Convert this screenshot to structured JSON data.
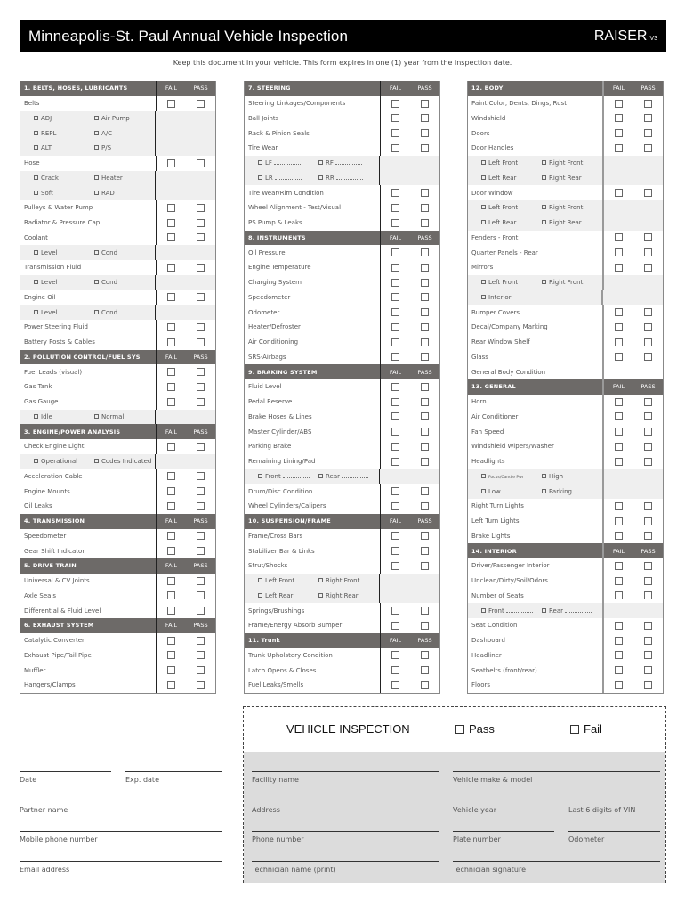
{
  "header": {
    "title": "Minneapolis-St. Paul Annual Vehicle Inspection",
    "brand": "RAISER",
    "version": "V3",
    "subtitle": "Keep this document in your vehicle. This form expires in one (1) year from the inspection date."
  },
  "columns_labels": {
    "fail": "FAIL",
    "pass": "PASS"
  },
  "col1": [
    {
      "type": "hdr",
      "label": "1. BELTS, HOSES, LUBRICANTS"
    },
    {
      "type": "item",
      "label": "Belts"
    },
    {
      "type": "sub",
      "opts": [
        "ADJ",
        "Air Pump"
      ]
    },
    {
      "type": "sub",
      "opts": [
        "REPL",
        "A/C"
      ]
    },
    {
      "type": "sub",
      "opts": [
        "ALT",
        "P/S"
      ]
    },
    {
      "type": "item",
      "label": "Hose"
    },
    {
      "type": "sub",
      "opts": [
        "Crack",
        "Heater"
      ]
    },
    {
      "type": "sub",
      "opts": [
        "Soft",
        "RAD"
      ]
    },
    {
      "type": "item",
      "label": "Pulleys & Water Pump"
    },
    {
      "type": "item",
      "label": "Radiator & Pressure Cap"
    },
    {
      "type": "item",
      "label": "Coolant"
    },
    {
      "type": "sub",
      "opts": [
        "Level",
        "Cond"
      ]
    },
    {
      "type": "item",
      "label": "Transmission Fluid"
    },
    {
      "type": "sub",
      "opts": [
        "Level",
        "Cond"
      ]
    },
    {
      "type": "item",
      "label": "Engine Oil"
    },
    {
      "type": "sub",
      "opts": [
        "Level",
        "Cond"
      ]
    },
    {
      "type": "item",
      "label": "Power Steering Fluid"
    },
    {
      "type": "item",
      "label": "Battery Posts & Cables"
    },
    {
      "type": "hdr",
      "label": "2. POLLUTION CONTROL/FUEL SYS"
    },
    {
      "type": "item",
      "label": "Fuel Leads (visual)"
    },
    {
      "type": "item",
      "label": "Gas Tank"
    },
    {
      "type": "item",
      "label": "Gas Gauge"
    },
    {
      "type": "sub",
      "opts": [
        "Idle",
        "Normal"
      ]
    },
    {
      "type": "hdr",
      "label": "3. ENGINE/POWER ANALYSIS"
    },
    {
      "type": "item",
      "label": "Check Engine Light"
    },
    {
      "type": "sub",
      "opts": [
        "Operational",
        "Codes Indicated"
      ]
    },
    {
      "type": "item",
      "label": "Acceleration Cable"
    },
    {
      "type": "item",
      "label": "Engine Mounts"
    },
    {
      "type": "item",
      "label": "Oil Leaks"
    },
    {
      "type": "hdr",
      "label": "4. TRANSMISSION"
    },
    {
      "type": "item",
      "label": "Speedometer"
    },
    {
      "type": "item",
      "label": "Gear Shift Indicator"
    },
    {
      "type": "hdr",
      "label": "5. DRIVE TRAIN"
    },
    {
      "type": "item",
      "label": "Universal & CV Joints"
    },
    {
      "type": "item",
      "label": "Axle Seals"
    },
    {
      "type": "item",
      "label": "Differential & Fluid Level"
    },
    {
      "type": "hdr",
      "label": "6. EXHAUST SYSTEM"
    },
    {
      "type": "item",
      "label": "Catalytic Converter"
    },
    {
      "type": "item",
      "label": "Exhaust Pipe/Tail Pipe"
    },
    {
      "type": "item",
      "label": "Muffler"
    },
    {
      "type": "item",
      "label": "Hangers/Clamps"
    }
  ],
  "col2": [
    {
      "type": "hdr",
      "label": "7. STEERING"
    },
    {
      "type": "item",
      "label": "Steering Linkages/Components"
    },
    {
      "type": "item",
      "label": "Ball Joints"
    },
    {
      "type": "item",
      "label": "Rack & Pinion Seals"
    },
    {
      "type": "item",
      "label": "Tire Wear"
    },
    {
      "type": "sub",
      "opts": [
        "LF",
        "RF"
      ],
      "blanks": true
    },
    {
      "type": "sub",
      "opts": [
        "LR",
        "RR"
      ],
      "blanks": true
    },
    {
      "type": "item",
      "label": "Tire Wear/Rim Condition"
    },
    {
      "type": "item",
      "label": "Wheel Alignment - Test/Visual"
    },
    {
      "type": "item",
      "label": "PS Pump & Leaks"
    },
    {
      "type": "hdr",
      "label": "8. INSTRUMENTS"
    },
    {
      "type": "item",
      "label": "Oil Pressure"
    },
    {
      "type": "item",
      "label": "Engine Temperature"
    },
    {
      "type": "item",
      "label": "Charging System"
    },
    {
      "type": "item",
      "label": "Speedometer"
    },
    {
      "type": "item",
      "label": "Odometer"
    },
    {
      "type": "item",
      "label": "Heater/Defroster"
    },
    {
      "type": "item",
      "label": "Air Conditioning"
    },
    {
      "type": "item",
      "label": "SRS-Airbags"
    },
    {
      "type": "hdr",
      "label": "9. BRAKING SYSTEM"
    },
    {
      "type": "item",
      "label": "Fluid Level"
    },
    {
      "type": "item",
      "label": "Pedal Reserve"
    },
    {
      "type": "item",
      "label": "Brake Hoses & Lines"
    },
    {
      "type": "item",
      "label": "Master Cylinder/ABS"
    },
    {
      "type": "item",
      "label": "Parking Brake"
    },
    {
      "type": "item",
      "label": "Remaining Lining/Pad"
    },
    {
      "type": "sub",
      "opts": [
        "Front",
        "Rear"
      ],
      "blanks": true
    },
    {
      "type": "item",
      "label": "Drum/Disc Condition"
    },
    {
      "type": "item",
      "label": "Wheel Cylinders/Calipers"
    },
    {
      "type": "hdr",
      "label": "10. SUSPENSION/FRAME"
    },
    {
      "type": "item",
      "label": "Frame/Cross Bars"
    },
    {
      "type": "item",
      "label": "Stabilizer Bar & Links"
    },
    {
      "type": "item",
      "label": "Strut/Shocks"
    },
    {
      "type": "sub",
      "opts": [
        "Left Front",
        "Right Front"
      ]
    },
    {
      "type": "sub",
      "opts": [
        "Left Rear",
        "Right Rear"
      ]
    },
    {
      "type": "item",
      "label": "Springs/Brushings"
    },
    {
      "type": "item",
      "label": "Frame/Energy Absorb Bumper"
    },
    {
      "type": "hdr",
      "label": "11. Trunk"
    },
    {
      "type": "item",
      "label": "Trunk Upholstery Condition"
    },
    {
      "type": "item",
      "label": "Latch Opens & Closes"
    },
    {
      "type": "item",
      "label": "Fuel Leaks/Smells"
    }
  ],
  "col3": [
    {
      "type": "hdr",
      "label": "12. BODY"
    },
    {
      "type": "item",
      "label": "Paint Color, Dents, Dings, Rust"
    },
    {
      "type": "item",
      "label": "Windshield"
    },
    {
      "type": "item",
      "label": "Doors"
    },
    {
      "type": "item",
      "label": "Door Handles"
    },
    {
      "type": "sub",
      "opts": [
        "Left Front",
        "Right Front"
      ]
    },
    {
      "type": "sub",
      "opts": [
        "Left Rear",
        "Right Rear"
      ]
    },
    {
      "type": "item",
      "label": "Door Window"
    },
    {
      "type": "sub",
      "opts": [
        "Left Front",
        "Right Front"
      ]
    },
    {
      "type": "sub",
      "opts": [
        "Left Rear",
        "Right Rear"
      ]
    },
    {
      "type": "item",
      "label": "Fenders - Front"
    },
    {
      "type": "item",
      "label": "Quarter Panels - Rear"
    },
    {
      "type": "item",
      "label": "Mirrors"
    },
    {
      "type": "sub",
      "opts": [
        "Left Front",
        "Right Front"
      ]
    },
    {
      "type": "sub",
      "opts": [
        "Interior"
      ]
    },
    {
      "type": "item",
      "label": "Bumper Covers"
    },
    {
      "type": "item",
      "label": "Decal/Company Marking"
    },
    {
      "type": "item",
      "label": "Rear Window Shelf"
    },
    {
      "type": "item",
      "label": "Glass"
    },
    {
      "type": "item",
      "label": "General Body Condition",
      "nocb": true
    },
    {
      "type": "hdr",
      "label": "13. GENERAL"
    },
    {
      "type": "item",
      "label": "Horn"
    },
    {
      "type": "item",
      "label": "Air Conditioner"
    },
    {
      "type": "item",
      "label": "Fan Speed"
    },
    {
      "type": "item",
      "label": "Windshield Wipers/Washer"
    },
    {
      "type": "item",
      "label": "Headlights"
    },
    {
      "type": "sub",
      "opts": [
        "Focus/Candle Pwr",
        "High"
      ],
      "tinyFirst": true
    },
    {
      "type": "sub",
      "opts": [
        "Low",
        "Parking"
      ]
    },
    {
      "type": "item",
      "label": "Right Turn Lights"
    },
    {
      "type": "item",
      "label": "Left Turn Lights"
    },
    {
      "type": "item",
      "label": "Brake Lights"
    },
    {
      "type": "hdr",
      "label": "14. INTERIOR"
    },
    {
      "type": "item",
      "label": "Driver/Passenger Interior"
    },
    {
      "type": "item",
      "label": "Unclean/Dirty/Soil/Odors"
    },
    {
      "type": "item",
      "label": "Number of Seats"
    },
    {
      "type": "sub",
      "opts": [
        "Front",
        "Rear"
      ],
      "blanks": true
    },
    {
      "type": "item",
      "label": "Seat Condition"
    },
    {
      "type": "item",
      "label": "Dashboard"
    },
    {
      "type": "item",
      "label": "Headliner"
    },
    {
      "type": "item",
      "label": "Seatbelts (front/rear)"
    },
    {
      "type": "item",
      "label": "Floors"
    }
  ],
  "vehicle_inspection": {
    "title": "VEHICLE INSPECTION",
    "pass_label": "Pass",
    "fail_label": "Fail"
  },
  "left_fields": {
    "date": "Date",
    "exp_date": "Exp. date",
    "partner_name": "Partner name",
    "mobile_phone": "Mobile phone number",
    "email": "Email address"
  },
  "right_fields": {
    "facility_name": "Facility name",
    "vehicle_make_model": "Vehicle make & model",
    "address": "Address",
    "vehicle_year": "Vehicle year",
    "last6_vin": "Last 6 digits of VIN",
    "phone_number": "Phone number",
    "plate_number": "Plate number",
    "odometer": "Odometer",
    "technician_name": "Technician name (print)",
    "technician_signature": "Technician signature"
  }
}
